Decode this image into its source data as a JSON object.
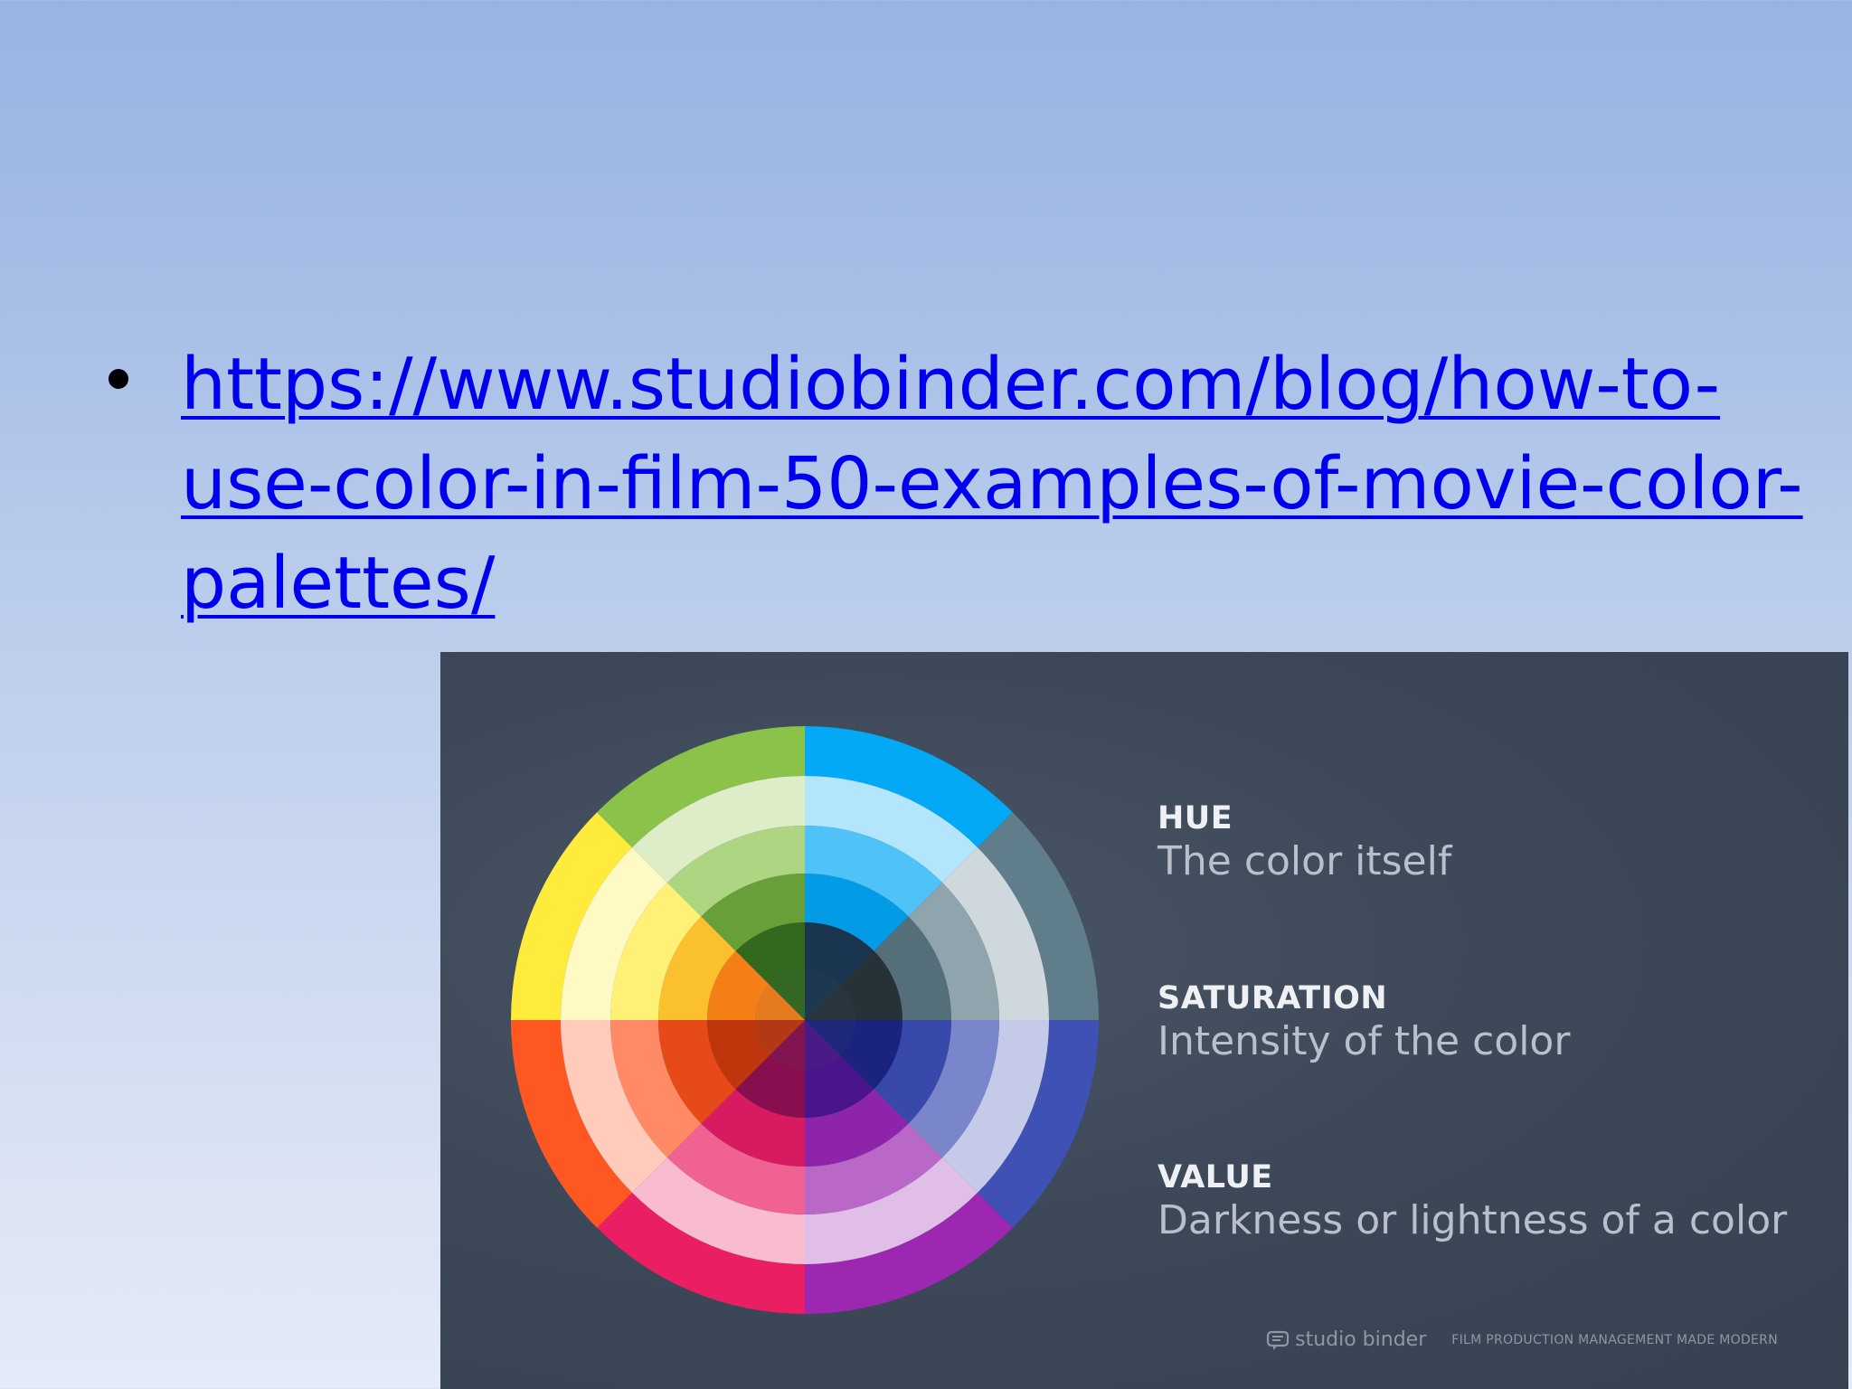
{
  "slide": {
    "link_lines": [
      "https://www.studiobinder.com/blog/how-to-",
      "use-color-in-film-50-examples-of-movie-color-",
      "palettes/"
    ]
  },
  "figure": {
    "legend": [
      {
        "term": "HUE",
        "description": "The color itself"
      },
      {
        "term": "SATURATION",
        "description": "Intensity of the color"
      },
      {
        "term": "VALUE",
        "description": "Darkness or lightness of a color"
      }
    ],
    "footer_logo": "studio binder",
    "footer_tagline": "FILM PRODUCTION MANAGEMENT MADE MODERN",
    "wheel_segments": [
      {
        "name": "blue",
        "colors": [
          "#03a9f4",
          "#b3e5fc",
          "#4fc3f7",
          "#039be5",
          "#1a3550"
        ]
      },
      {
        "name": "blue-grey",
        "colors": [
          "#607d8b",
          "#cfd8dc",
          "#90a4ae",
          "#546e7a",
          "#263238"
        ]
      },
      {
        "name": "indigo",
        "colors": [
          "#3f51b5",
          "#c5cae9",
          "#7986cb",
          "#3949ab",
          "#1a237e"
        ]
      },
      {
        "name": "purple",
        "colors": [
          "#9c27b0",
          "#e1bee7",
          "#ba68c8",
          "#8e24aa",
          "#4a148c"
        ]
      },
      {
        "name": "pink",
        "colors": [
          "#e91e63",
          "#f8bbd0",
          "#f06292",
          "#d81b60",
          "#880e4f"
        ]
      },
      {
        "name": "red-orange",
        "colors": [
          "#ff5722",
          "#ffccbc",
          "#ff8a65",
          "#e64a19",
          "#bf360c"
        ]
      },
      {
        "name": "yellow",
        "colors": [
          "#ffeb3b",
          "#fff9c4",
          "#fff176",
          "#fbc02d",
          "#f57f17"
        ]
      },
      {
        "name": "green",
        "colors": [
          "#8bc34a",
          "#dcedc8",
          "#aed581",
          "#689f38",
          "#33691e"
        ]
      }
    ]
  }
}
